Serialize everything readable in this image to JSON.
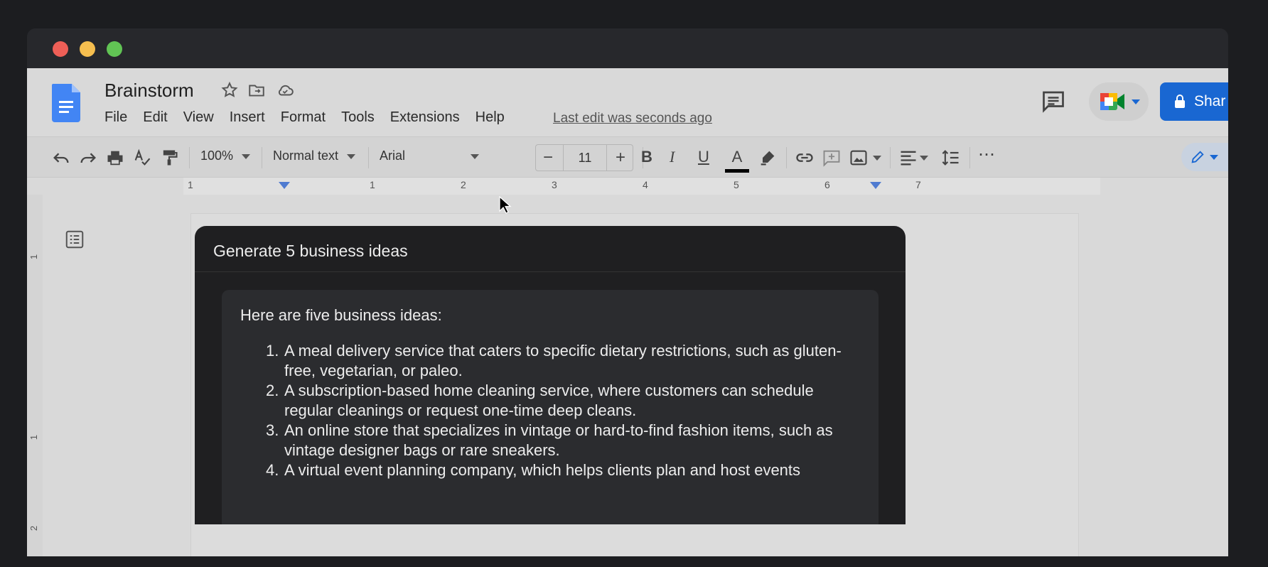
{
  "document": {
    "title": "Brainstorm",
    "last_edit": "Last edit was seconds ago"
  },
  "menu": [
    "File",
    "Edit",
    "View",
    "Insert",
    "Format",
    "Tools",
    "Extensions",
    "Help"
  ],
  "toolbar": {
    "zoom": "100%",
    "style": "Normal text",
    "font": "Arial",
    "font_size": "11",
    "minus": "−",
    "plus": "+",
    "bold": "B",
    "italic": "I",
    "underline": "U",
    "text_color": "A",
    "more": "⋯"
  },
  "share": {
    "label": "Shar"
  },
  "ruler": {
    "numbers": [
      "1",
      "1",
      "2",
      "3",
      "4",
      "5",
      "6",
      "7"
    ]
  },
  "vruler": {
    "numbers": [
      "1",
      "1",
      "2"
    ]
  },
  "dialog": {
    "title": "Generate 5 business ideas",
    "intro": "Here are five business ideas:",
    "ideas": [
      {
        "num": "1.",
        "text": "A meal delivery service that caters to specific dietary restrictions, such as gluten-free, vegetarian, or paleo."
      },
      {
        "num": "2.",
        "text": "A subscription-based home cleaning service, where customers can schedule regular cleanings or request one-time deep cleans."
      },
      {
        "num": "3.",
        "text": "An online store that specializes in vintage or hard-to-find fashion items, such as vintage designer bags or rare sneakers."
      },
      {
        "num": "4.",
        "text": "A virtual event planning company, which helps clients plan and host events"
      }
    ]
  },
  "colors": {
    "share_blue": "#1967d2",
    "docs_blue": "#4285f4",
    "dialog_bg": "#1f1f21"
  }
}
